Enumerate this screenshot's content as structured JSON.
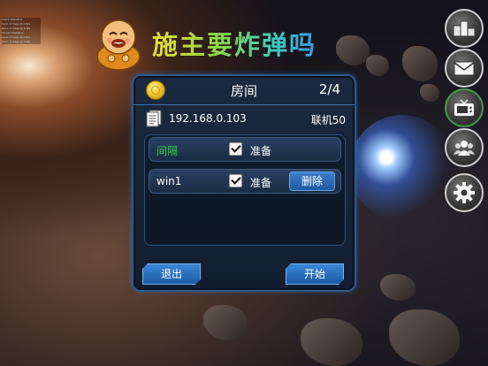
{
  "title": "施主要炸弹吗",
  "debug_text": [
    "Client Statistics",
    "Sent: 0 msgs @ 0 B/s",
    "Recv: 0 msgs @ 0 B/s",
    "Server Statistics",
    "Sent: 0 msgs @ 0 B/s",
    "Recv: 0 msgs @ 0 B/s"
  ],
  "side_buttons": [
    {
      "name": "leaderboard",
      "icon": "podium-icon"
    },
    {
      "name": "mail",
      "icon": "envelope-icon"
    },
    {
      "name": "tv",
      "icon": "tv-icon"
    },
    {
      "name": "friends",
      "icon": "people-icon"
    },
    {
      "name": "settings",
      "icon": "gear-icon"
    }
  ],
  "room": {
    "title": "房间",
    "count": "2/4",
    "ip": "192.168.0.103",
    "mode": "联机50",
    "players": [
      {
        "name": "间隔",
        "ready_label": "准备",
        "checked": true,
        "name_color": "#33d14a",
        "has_delete": false
      },
      {
        "name": "win1",
        "ready_label": "准备",
        "checked": true,
        "name_color": "#ffffff",
        "has_delete": true,
        "delete_label": "删除"
      }
    ],
    "exit_label": "退出",
    "start_label": "开始"
  },
  "colors": {
    "accent": "#2f5a8c",
    "button": "#2a6fc0"
  }
}
